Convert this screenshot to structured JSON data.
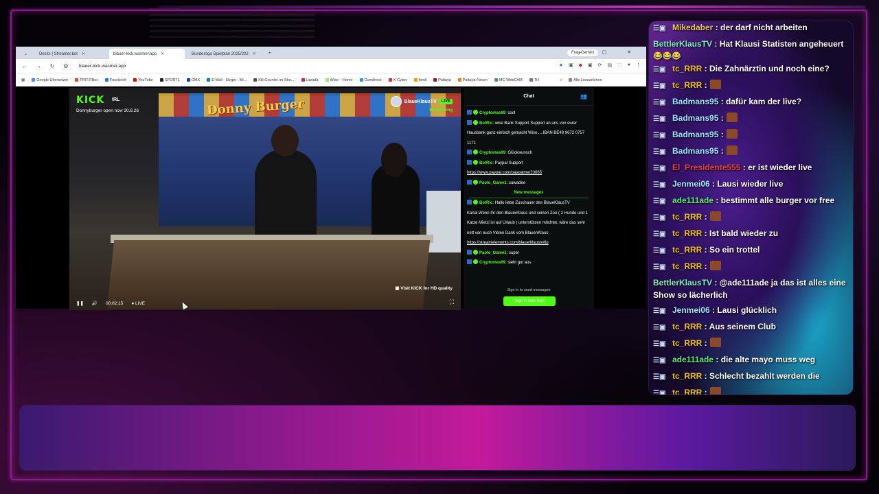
{
  "browser": {
    "tabs": [
      {
        "label": "Decks | Streamer.bot"
      },
      {
        "label": "blauer-kick.wasmer.app"
      },
      {
        "label": "Bundesliga Spielplan 2025/202"
      }
    ],
    "gemini": "Frag Gemini",
    "url": "blauer-kick.wasmer.app",
    "bookmarks": [
      "Google Übersetzer",
      "FRITZ!Box",
      "Facebook",
      "YouTube",
      "SPORT1",
      "GMX",
      "E-Mail - Skype - Mi...",
      "Kill-Counter im Stre...",
      "Lazada",
      "Wise – Home",
      "Comdirect",
      "K-Cyber",
      "foniil",
      "Pattaya",
      "Pattaya Forum",
      "MC-WebCAM",
      "TH"
    ],
    "bookmarks_more": "Alle Lesezeichen"
  },
  "video": {
    "logo": "KICK",
    "category": "IRL",
    "title": "Donnyburger open now 30.8.26",
    "sign": "Donny Burger",
    "channel": "BlaueKlausTV",
    "live": "LIVE",
    "watching": "14 watching",
    "hd_note": "Visit KICK for HD quality",
    "time": "00:02:15",
    "live_label": "LIVE"
  },
  "kick_chat": {
    "title": "Chat",
    "messages": [
      {
        "user": "Cryptomas69",
        "text": "cool",
        "color": "#53fc18"
      },
      {
        "user": "BotRic",
        "text": "wise Bank Support Support an uns von eurer Hausbank ganz einfach gemacht Wise.....IBAN BE49 9672 0757 1171",
        "color": "#53fc18"
      },
      {
        "user": "Cryptomas69",
        "text": "Glückwunsch",
        "color": "#53fc18"
      },
      {
        "user": "BotRic",
        "text": "Paypal Support",
        "color": "#53fc18"
      },
      {
        "user": "",
        "text": "https://www.paypal.com/paypalme/23665",
        "color": "#fff"
      },
      {
        "user": "Paolo_Game1",
        "text": "sawadee",
        "color": "#53fc18"
      }
    ],
    "new_messages": "New messages",
    "messages2": [
      {
        "user": "BotRic",
        "text": "Hallo liebe Zuschauer des BlaueKlausTV Kanal.Wenn Ihr den BlauenKlaus und seinen Zoo ( 2 Hunde und 1 Katze Mietzi ist auf Urlaub ) unterstützen möchtet, wäre das sehr nett von euch Vielen Dank vom BlauenKlaus",
        "color": "#53fc18"
      },
      {
        "user": "",
        "text": "https://streamelements.com/blauerklaustv/tip",
        "color": "#fff"
      },
      {
        "user": "Paolo_Game1",
        "text": "super",
        "color": "#53fc18"
      },
      {
        "user": "Cryptomas69",
        "text": "sieht gut aus",
        "color": "#53fc18"
      }
    ],
    "signin_note": "Sign in to send messages",
    "signin_button": "Sign in with Kick"
  },
  "overlay_chat": [
    {
      "user": "Mikedaber",
      "text": ": der darf nicht arbeiten",
      "color": "#e8c95a"
    },
    {
      "user": "BettlerKlausTV",
      "text": ": Hat Klausi Statisten angeheuert",
      "color": "#7cf0b8",
      "emotes": "😂😂😂"
    },
    {
      "user": "tc_RRR",
      "text": ": Die Zahnärztin und noch eine?",
      "color": "#f0c020"
    },
    {
      "user": "tc_RRR",
      "text": ":",
      "color": "#f0c020",
      "emote": true
    },
    {
      "user": "Badmans95",
      "text": ": dafür kam der live?",
      "color": "#9ee8ff"
    },
    {
      "user": "Badmans95",
      "text": ":",
      "color": "#9ee8ff",
      "emote": true
    },
    {
      "user": "Badmans95",
      "text": ":",
      "color": "#9ee8ff",
      "emote": true
    },
    {
      "user": "Badmans95",
      "text": ":",
      "color": "#9ee8ff",
      "emote": true
    },
    {
      "user": "El_Presidente555",
      "text": ": er ist wieder live",
      "color": "#e8403a"
    },
    {
      "user": "Jenmei06",
      "text": ": Lausi wieder live",
      "color": "#9ee8ff"
    },
    {
      "user": "ade111ade",
      "text": ": bestimmt alle burger vor free",
      "color": "#5ee870"
    },
    {
      "user": "tc_RRR",
      "text": ":",
      "color": "#f0c020",
      "emote": true
    },
    {
      "user": "tc_RRR",
      "text": ": Ist bald wieder zu",
      "color": "#f0c020"
    },
    {
      "user": "tc_RRR",
      "text": ": So ein trottel",
      "color": "#f0c020"
    },
    {
      "user": "tc_RRR",
      "text": ":",
      "color": "#f0c020",
      "emote": true
    },
    {
      "user": "BettlerKlausTV",
      "text": ": @ade111ade ja das ist alles eine Show so lächerlich",
      "color": "#7cf0b8"
    },
    {
      "user": "Jenmei06",
      "text": ": Lausi glücklich",
      "color": "#9ee8ff"
    },
    {
      "user": "tc_RRR",
      "text": ": Aus seinem Club",
      "color": "#f0c020"
    },
    {
      "user": "tc_RRR",
      "text": ":",
      "color": "#f0c020",
      "emote": true
    },
    {
      "user": "ade111ade",
      "text": ": die alte mayo muss weg",
      "color": "#5ee870"
    },
    {
      "user": "tc_RRR",
      "text": ": Schlecht bezahlt werden die",
      "color": "#f0c020"
    },
    {
      "user": "tc_RRR",
      "text": ":",
      "color": "#f0c020",
      "emote": true
    }
  ],
  "colors": {
    "kick_green": "#53fc18",
    "frame": "#8a1e86"
  },
  "icons": [
    "search-icon",
    "star-icon",
    "pause-icon",
    "volume-icon",
    "fullscreen-icon",
    "users-icon"
  ]
}
